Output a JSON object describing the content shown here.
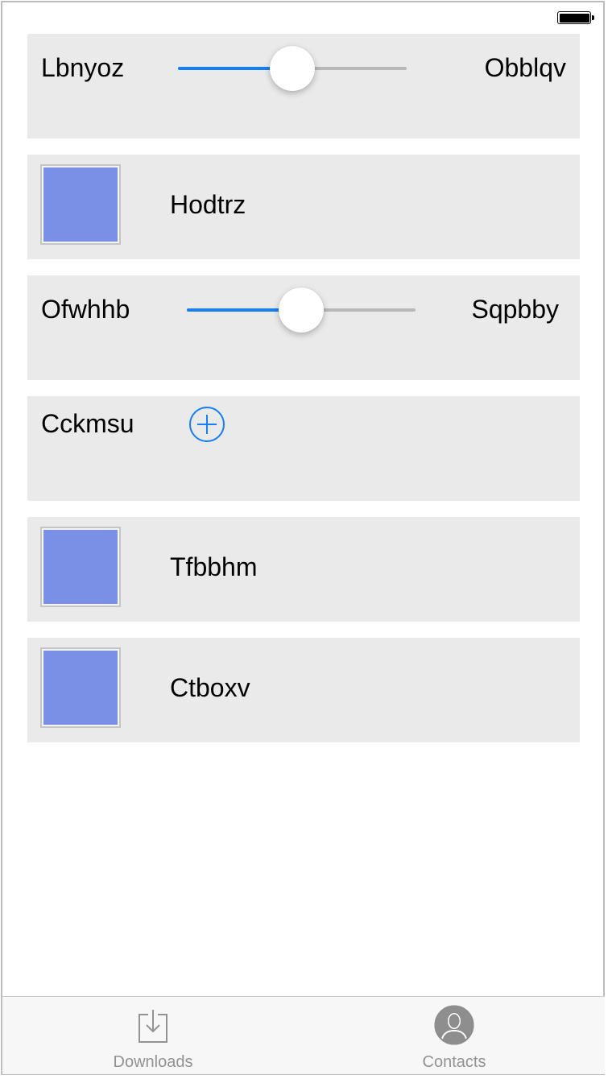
{
  "status_bar": {
    "battery_icon": "battery-full-icon"
  },
  "rows": [
    {
      "type": "slider",
      "left_label": "Lbnyoz",
      "right_label": "Obblqv",
      "value": 0.5
    },
    {
      "type": "swatch",
      "label": "Hodtrz",
      "color": "#7a8fe6"
    },
    {
      "type": "slider",
      "left_label": "Ofwhhb",
      "right_label": "Sqpbby",
      "value": 0.5
    },
    {
      "type": "add",
      "label": "Cckmsu",
      "icon": "add-circle-icon"
    },
    {
      "type": "swatch",
      "label": "Tfbbhm",
      "color": "#7a8fe6"
    },
    {
      "type": "swatch",
      "label": "Ctboxv",
      "color": "#7a8fe6"
    }
  ],
  "tabbar": {
    "tabs": [
      {
        "label": "Downloads",
        "icon": "downloads-icon"
      },
      {
        "label": "Contacts",
        "icon": "contacts-icon"
      }
    ]
  },
  "colors": {
    "accent": "#147efb",
    "card_bg": "#eaeaea",
    "swatch": "#7a8fe6"
  }
}
